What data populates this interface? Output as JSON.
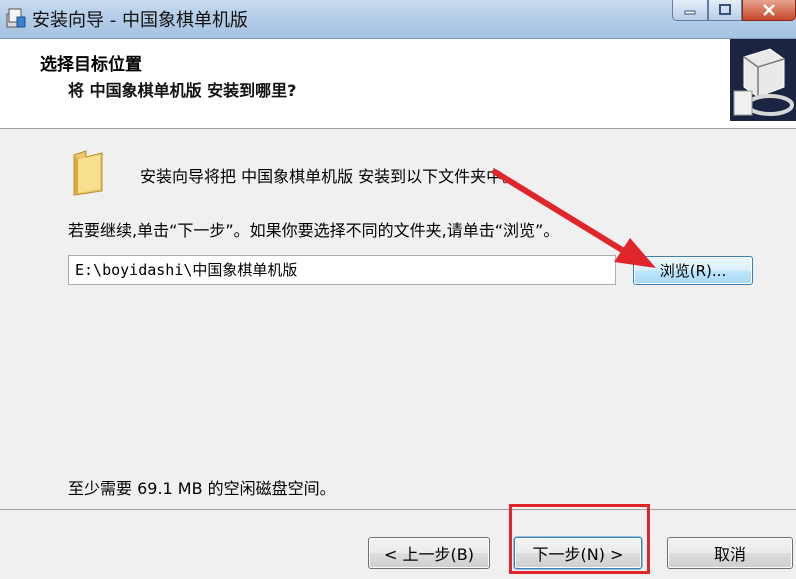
{
  "window": {
    "title": "安装向导 - 中国象棋单机版",
    "app_icon": "installer-icon",
    "controls": [
      "minimize-icon",
      "maximize-icon",
      "close-icon"
    ]
  },
  "header": {
    "title": "选择目标位置",
    "subtitle": "将 中国象棋单机版 安装到哪里?",
    "icon": "computer-install-icon"
  },
  "content": {
    "folder_icon": "folder-icon",
    "intro": "安装向导将把 中国象棋单机版 安装到以下文件夹中。",
    "instruction": "若要继续,单击“下一步”。如果你要选择不同的文件夹,请单击“浏览”。",
    "install_path": "E:\\boyidashi\\中国象棋单机版",
    "browse_label": "浏览(R)...",
    "space_required": "至少需要 69.1 MB 的空闲磁盘空间。"
  },
  "footer": {
    "back_label": "< 上一步(B)",
    "next_label": "下一步(N) >",
    "cancel_label": "取消"
  },
  "colors": {
    "annotation": "#e0262b",
    "titlebar": "#b4cde8",
    "button_focus": "#3c7fb1"
  }
}
